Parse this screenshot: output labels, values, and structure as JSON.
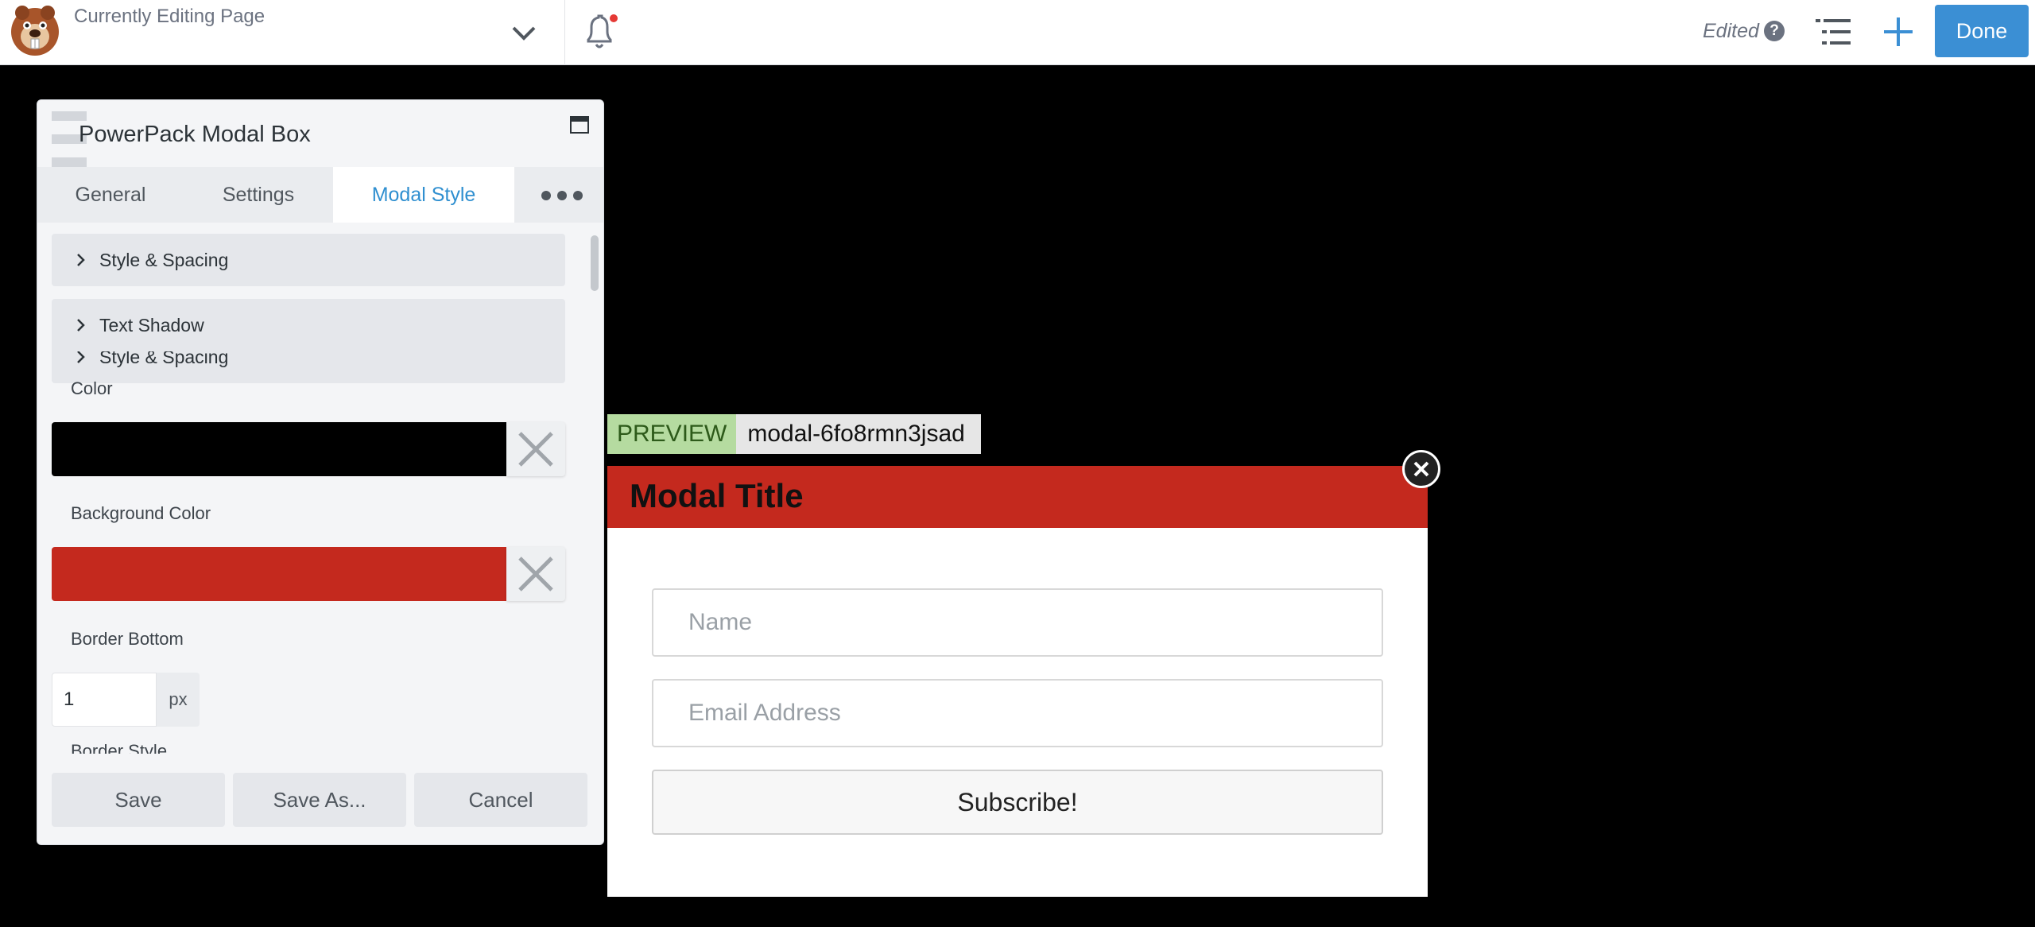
{
  "topbar": {
    "editing_label": "Currently Editing Page",
    "edited_label": "Edited",
    "help_glyph": "?",
    "done_label": "Done",
    "notification_dot_color": "#e53935",
    "accent_color": "#3b8fd4"
  },
  "panel": {
    "title": "PowerPack Modal Box",
    "tabs": [
      {
        "label": "General"
      },
      {
        "label": "Settings"
      },
      {
        "label": "Modal Style"
      }
    ],
    "active_tab": "Modal Style",
    "sections": [
      {
        "label": "Style & Spacing"
      },
      {
        "label": "Text Shadow"
      }
    ],
    "fields": {
      "color_label": "Color",
      "color_value": "#000000",
      "bg_color_label": "Background Color",
      "bg_color_value": "#c4291e",
      "border_bottom_label": "Border Bottom",
      "border_bottom_value": "1",
      "border_bottom_unit": "px",
      "border_style_label": "Border Style"
    },
    "footer": {
      "save": "Save",
      "save_as": "Save As...",
      "cancel": "Cancel"
    }
  },
  "preview": {
    "badge": "PREVIEW",
    "modal_id": "modal-6fo8rmn3jsad",
    "modal_title": "Modal Title",
    "name_placeholder": "Name",
    "email_placeholder": "Email Address",
    "subscribe_label": "Subscribe!"
  }
}
